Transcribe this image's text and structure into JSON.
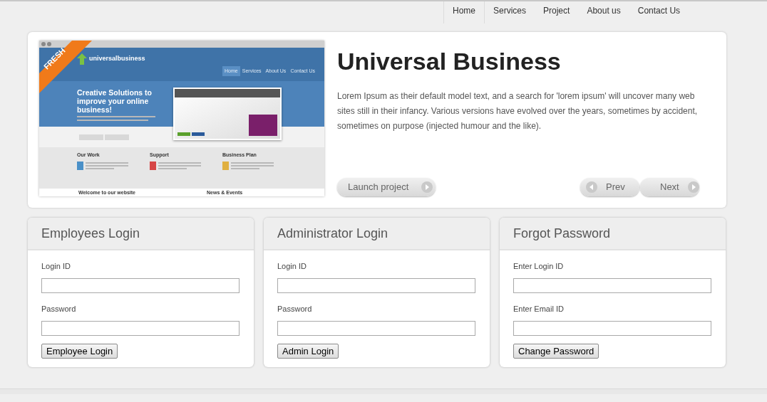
{
  "nav": [
    {
      "label": "Home",
      "selected": true
    },
    {
      "label": "Services",
      "selected": false
    },
    {
      "label": "Project",
      "selected": false
    },
    {
      "label": "About us",
      "selected": false
    },
    {
      "label": "Contact Us",
      "selected": false
    }
  ],
  "slider": {
    "preview": {
      "ribbon": "FRESH",
      "logo": "universalbusiness",
      "nav": [
        {
          "label": "Home",
          "selected": true
        },
        {
          "label": "Services",
          "selected": false
        },
        {
          "label": "About Us",
          "selected": false
        },
        {
          "label": "Contact Us",
          "selected": false
        }
      ],
      "headline": "Creative Solutions to improve your online business!",
      "columns": [
        "Our Work",
        "Support",
        "Business Plan"
      ],
      "footer_headings": [
        "Welcome to our website",
        "News & Events"
      ]
    },
    "title": "Universal Business",
    "text": "Lorem Ipsum as their default model text, and a search for 'lorem ipsum' will uncover many web sites still in their infancy. Various versions have evolved over the years, sometimes by accident, sometimes on purpose (injected humour and the like).",
    "launch": {
      "label": "Launch project"
    },
    "pager": [
      {
        "label": "Prev",
        "kind": "back"
      },
      {
        "label": "Next",
        "kind": "forward"
      }
    ]
  },
  "panels": [
    {
      "title": "Employees Login",
      "fields": [
        {
          "label": "Login ID"
        },
        {
          "label": "Password"
        }
      ],
      "button": "Employee Login"
    },
    {
      "title": "Administrator Login",
      "fields": [
        {
          "label": "Login ID"
        },
        {
          "label": "Password"
        }
      ],
      "button": "Admin Login"
    },
    {
      "title": "Forgot Password",
      "fields": [
        {
          "label": "Enter Login ID"
        },
        {
          "label": "Enter Email ID"
        }
      ],
      "button": "Change Password"
    }
  ]
}
